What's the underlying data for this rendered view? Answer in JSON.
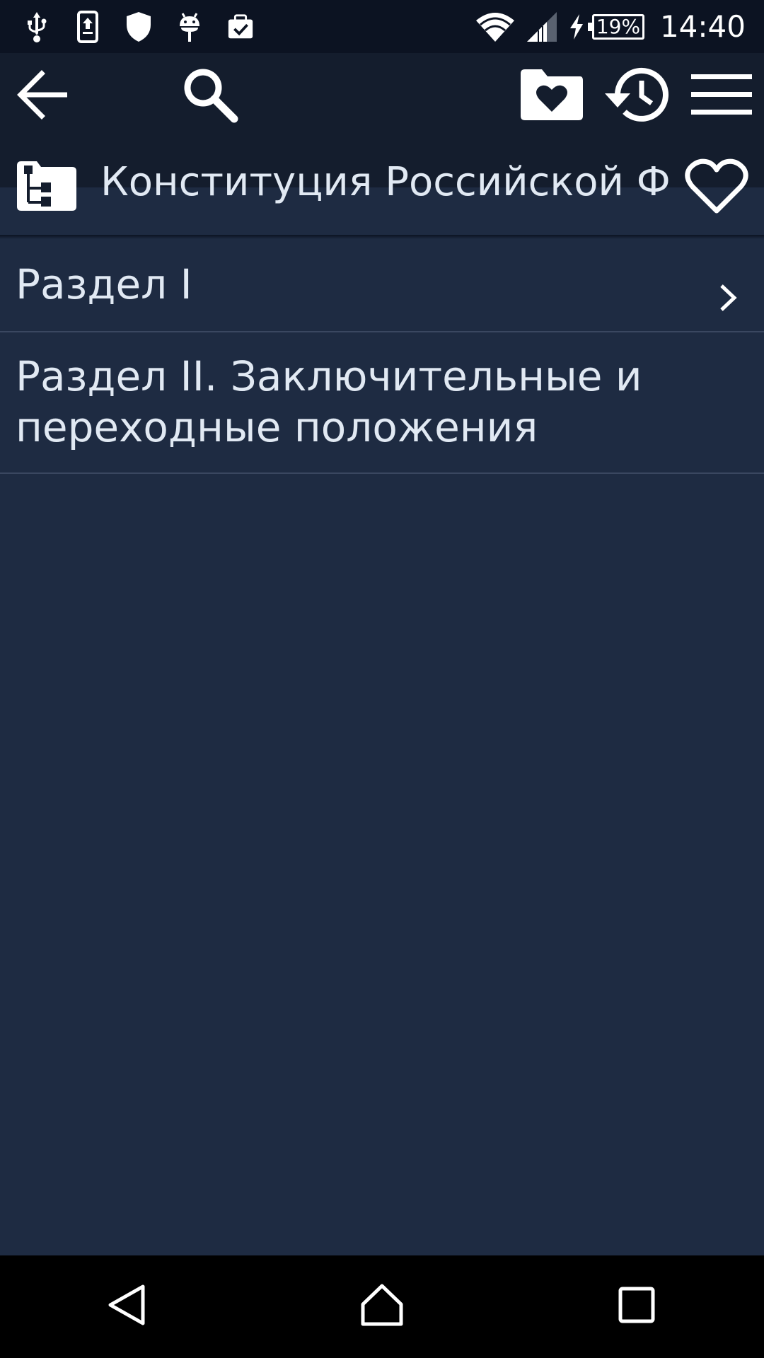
{
  "status_bar": {
    "left_icons": [
      "usb-icon",
      "phone-upload-icon",
      "shield-icon",
      "android-debug-icon",
      "briefcase-check-icon"
    ],
    "right_icons": [
      "wifi-icon",
      "signal-icon",
      "charging-bolt-icon"
    ],
    "battery_percent": "19%",
    "time": "14:40"
  },
  "toolbar": {
    "back_icon": "arrow-left-icon",
    "search_icon": "search-icon",
    "favorites_folder_icon": "folder-heart-icon",
    "history_icon": "history-icon",
    "menu_icon": "hamburger-menu-icon"
  },
  "document": {
    "title": "Конституция Российской Федерации",
    "icon": "folder-tree-icon",
    "favorite_icon": "heart-outline-icon"
  },
  "sections": [
    {
      "label": "Раздел I",
      "has_children": true
    },
    {
      "label": "Раздел II. Заключительные и переходные положения",
      "has_children": false
    }
  ],
  "navigation_bar": {
    "buttons": [
      "back-triangle-icon",
      "home-icon",
      "recents-icon"
    ]
  },
  "colors": {
    "background": "#1e2b42",
    "appbar": "#141d2d",
    "status_bar": "#0c1322",
    "text": "#e1e9f3",
    "divider": "#3a4760"
  }
}
